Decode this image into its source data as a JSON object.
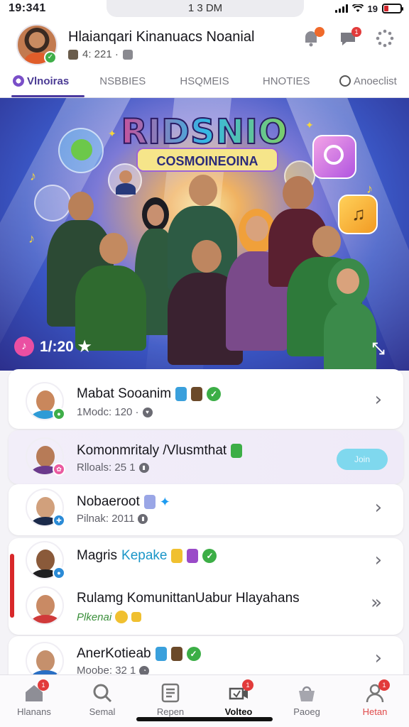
{
  "status": {
    "time": "19:341",
    "center": "1 3 DM",
    "battery_label": "19"
  },
  "header": {
    "title": "Hlaianqari Kinanuacs Noanial",
    "subtitle": "4: 221 ·",
    "icons": [
      "notification-icon",
      "chat-icon",
      "more-icon"
    ],
    "badges": {
      "notification": "",
      "chat": "1"
    }
  },
  "tabs": [
    {
      "label": "Vlnoiras",
      "active": true
    },
    {
      "label": "NSBBIES",
      "active": false
    },
    {
      "label": "HSQMEIS",
      "active": false
    },
    {
      "label": "HNOTIES",
      "active": false
    },
    {
      "label": "Anoeclist",
      "active": false
    }
  ],
  "banner": {
    "title": "RIDSNIO",
    "subtitle": "COSMOINEOINA",
    "count": "1/:20 ★"
  },
  "list": [
    {
      "title": "Mabat Sooanim",
      "title_extra": "",
      "sub": "1Modc: 120 ·",
      "verified": true,
      "trail": "chevron",
      "avatar_face": "#c9875c",
      "avatar_body": "#2f9bd6",
      "badge_color": "#3fae49"
    },
    {
      "title": "Komonmritaly /Vlusmthat",
      "title_extra": "",
      "sub": "Rlloals: 25 1",
      "verified": false,
      "trail": "join",
      "join_label": "Join",
      "avatar_face": "#b77b57",
      "avatar_body": "#6b3a8c",
      "badge_color": "#ea5aa0",
      "highlight": true
    },
    {
      "title": "Nobaeroot",
      "title_extra": "",
      "sub": "Pilnak: 2011",
      "verified": false,
      "trail": "chevron",
      "avatar_face": "#d1a07c",
      "avatar_body": "#1b2a4a",
      "badge_color": "#2b8bd6"
    },
    {
      "title": "Magris",
      "title_extra": "Kepake",
      "sub": "",
      "verified": true,
      "trail": "chevron",
      "avatar_face": "#8a5a3a",
      "avatar_body": "#1f1f22",
      "badge_color": "#2b8bd6"
    },
    {
      "title": "Rulamg KomunittanUabur Hlayahans",
      "title_extra": "",
      "sub": "Plkenai",
      "verified": false,
      "trail": "double",
      "avatar_face": "#c98a64",
      "avatar_body": "#d03a3a",
      "badge_color": "#3fae49"
    },
    {
      "title": "AnerKotieab",
      "title_extra": "",
      "sub": "Moobe: 32 1",
      "verified": true,
      "trail": "chevron",
      "avatar_face": "#c5906c",
      "avatar_body": "#2a6fc4",
      "badge_color": "#2b8bd6"
    }
  ],
  "nav": [
    {
      "label": "Hlanans",
      "icon": "home-icon",
      "badge": "1"
    },
    {
      "label": "Semal",
      "icon": "search-icon",
      "badge": ""
    },
    {
      "label": "Repen",
      "icon": "document-icon",
      "badge": ""
    },
    {
      "label": "Volteo",
      "icon": "video-icon",
      "badge": "1",
      "active": true
    },
    {
      "label": "Paoeg",
      "icon": "shop-icon",
      "badge": ""
    },
    {
      "label": "Hetan",
      "icon": "profile-icon",
      "badge": "1"
    }
  ]
}
